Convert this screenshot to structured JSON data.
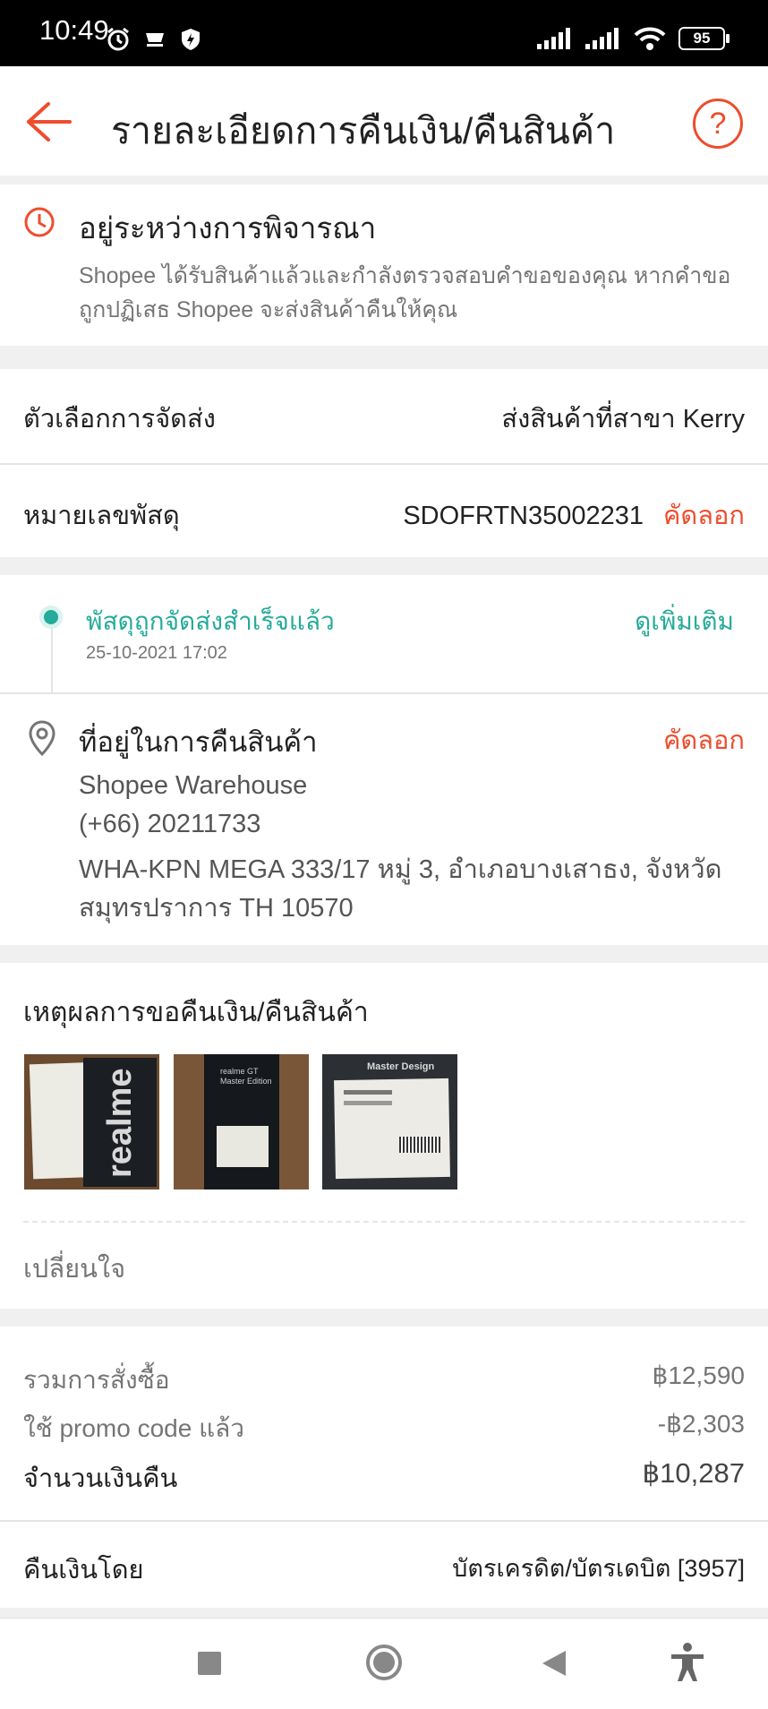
{
  "status_bar": {
    "time": "10:49",
    "battery": "95"
  },
  "header": {
    "title": "รายละเอียดการคืนเงิน/คืนสินค้า"
  },
  "status_card": {
    "title": "อยู่ระหว่างการพิจารณา",
    "description_line1": "Shopee ได้รับสินค้าแล้วและกำลังตรวจสอบคำขอของคุณ หากคำขอ",
    "description_line2": "ถูกปฏิเสธ Shopee จะส่งสินค้าคืนให้คุณ"
  },
  "shipping": {
    "option_label": "ตัวเลือกการจัดส่ง",
    "option_value": "ส่งสินค้าที่สาขา Kerry",
    "tracking_label": "หมายเลขพัสดุ",
    "tracking_value": "SDOFRTN35002231",
    "copy_label": "คัดลอก"
  },
  "tracking": {
    "status": "พัสดุถูกจัดส่งสำเร็จแล้ว",
    "timestamp": "25-10-2021 17:02",
    "see_more": "ดูเพิ่มเติม"
  },
  "address": {
    "title": "ที่อยู่ในการคืนสินค้า",
    "copy_label": "คัดลอก",
    "name": "Shopee Warehouse",
    "phone": "(+66) 20211733",
    "line1": "WHA-KPN MEGA 333/17 หมู่ 3, อำเภอบางเสาธง, จังหวัด",
    "line2": "สมุทรปราการ TH 10570"
  },
  "reason": {
    "title": "เหตุผลการขอคืนเงิน/คืนสินค้า",
    "text": "เปลี่ยนใจ",
    "thumb_text_1": "realme",
    "thumb_text_2": "realme GT\nMaster Edition",
    "thumb_text_3": "Master Design"
  },
  "summary": {
    "order_total_label": "รวมการสั่งซื้อ",
    "order_total_value": "฿12,590",
    "promo_label": "ใช้ promo code แล้ว",
    "promo_value": "-฿2,303",
    "refund_label": "จำนวนเงินคืน",
    "refund_value": "฿10,287"
  },
  "refund_method": {
    "label": "คืนเงินโดย",
    "value": "บัตรเครดิต/บัตรเดบิต [3957]"
  },
  "colors": {
    "accent": "#ee4d2d",
    "teal": "#26aa99"
  }
}
